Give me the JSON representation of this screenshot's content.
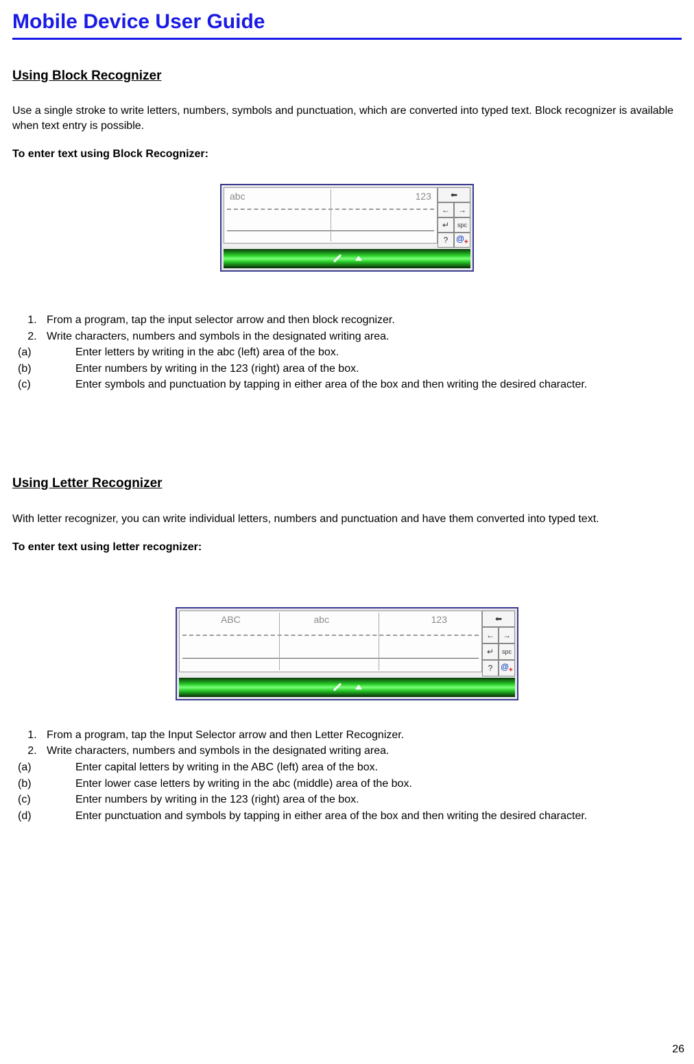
{
  "header": {
    "title": "Mobile Device User Guide"
  },
  "section1": {
    "heading": "Using Block Recognizer",
    "intro": "Use a single stroke to write letters, numbers, symbols and punctuation, which are converted into typed text. Block recognizer is available when text entry is possible.",
    "bold_label": "To enter text using Block Recognizer:",
    "panel": {
      "left_label": "abc",
      "right_label": "123",
      "btn_spc": "spc"
    },
    "list": {
      "item1": "From a program, tap the input selector arrow and then block recognizer.",
      "item2": "Write characters, numbers and symbols in the designated writing area.",
      "sub_a": "Enter letters by writing in the abc (left) area of the box.",
      "sub_b": "Enter numbers by writing in the 123 (right) area of the box.",
      "sub_c": "Enter symbols and punctuation by tapping in either area of the box and then writing the desired character."
    }
  },
  "section2": {
    "heading": "Using Letter Recognizer",
    "intro": "With letter recognizer, you can write individual letters, numbers and punctuation and have them converted into typed text.",
    "bold_label": "To enter text using letter recognizer:",
    "panel": {
      "left_label": "ABC",
      "mid_label": "abc",
      "right_label": "123",
      "btn_spc": "spc"
    },
    "list": {
      "item1": "From a program, tap the Input Selector arrow and then Letter Recognizer.",
      "item2": "Write characters, numbers and symbols in the designated writing area.",
      "sub_a": "Enter capital letters by writing in the ABC (left) area of the box.",
      "sub_b": "Enter lower case letters by writing in the abc (middle) area of the box.",
      "sub_c": "Enter numbers by writing in the 123 (right) area of the box.",
      "sub_d": "Enter punctuation and symbols by tapping in either area of the box and then writing the desired character."
    }
  },
  "markers": {
    "one": "1.",
    "two": "2.",
    "a": "(a)",
    "b": "(b)",
    "c": "(c)",
    "d": "(d)"
  },
  "page_number": "26"
}
